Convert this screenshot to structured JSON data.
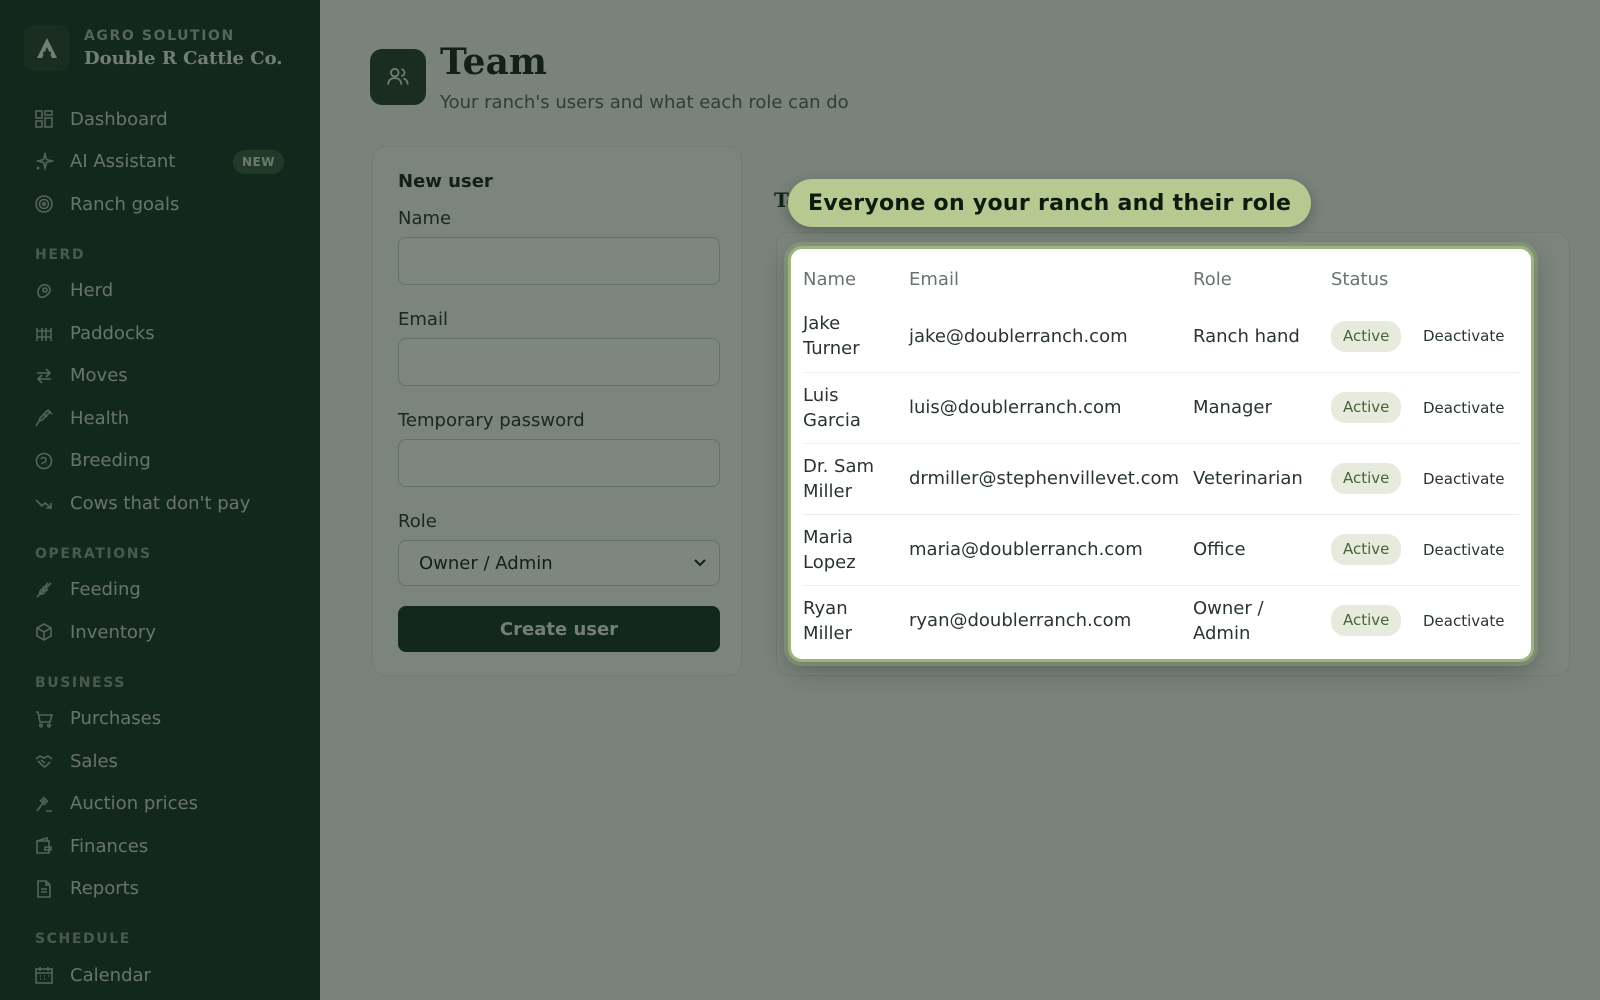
{
  "brand": {
    "kicker": "AGRO SOLUTION",
    "name": "Double R Cattle Co."
  },
  "sidebar": {
    "top": [
      {
        "label": "Dashboard",
        "icon": "dashboard-icon"
      },
      {
        "label": "AI Assistant",
        "icon": "sparkle-icon",
        "badge": "NEW"
      },
      {
        "label": "Ranch goals",
        "icon": "target-icon"
      }
    ],
    "herd_section": "HERD",
    "herd": [
      {
        "label": "Herd",
        "icon": "cow-icon"
      },
      {
        "label": "Paddocks",
        "icon": "fence-icon"
      },
      {
        "label": "Moves",
        "icon": "arrows-icon"
      },
      {
        "label": "Health",
        "icon": "syringe-icon"
      },
      {
        "label": "Breeding",
        "icon": "breeding-icon"
      },
      {
        "label": "Cows that don't pay",
        "icon": "trend-down-icon"
      }
    ],
    "operations_section": "OPERATIONS",
    "operations": [
      {
        "label": "Feeding",
        "icon": "wheat-icon"
      },
      {
        "label": "Inventory",
        "icon": "box-icon"
      }
    ],
    "business_section": "BUSINESS",
    "business": [
      {
        "label": "Purchases",
        "icon": "cart-icon"
      },
      {
        "label": "Sales",
        "icon": "handshake-icon"
      },
      {
        "label": "Auction prices",
        "icon": "gavel-icon"
      },
      {
        "label": "Finances",
        "icon": "wallet-icon"
      },
      {
        "label": "Reports",
        "icon": "document-icon"
      }
    ],
    "schedule_section": "SCHEDULE",
    "schedule": [
      {
        "label": "Calendar",
        "icon": "calendar-icon"
      }
    ]
  },
  "header": {
    "title": "Team",
    "subtitle": "Your ranch's users and what each role can do"
  },
  "new_user": {
    "title": "New user",
    "name_label": "Name",
    "email_label": "Email",
    "password_label": "Temporary password",
    "role_label": "Role",
    "role_value": "Owner / Admin",
    "create_label": "Create user"
  },
  "team": {
    "title_peek": "Te"
  },
  "tour": {
    "text": "Everyone on your ranch and their role"
  },
  "table": {
    "headers": [
      "Name",
      "Email",
      "Role",
      "Status"
    ],
    "rows": [
      {
        "name": "Jake Turner",
        "email": "jake@doublerranch.com",
        "role": "Ranch hand",
        "status": "Active",
        "action": "Deactivate"
      },
      {
        "name": "Luis Garcia",
        "email": "luis@doublerranch.com",
        "role": "Manager",
        "status": "Active",
        "action": "Deactivate"
      },
      {
        "name": "Dr. Sam Miller",
        "email": "drmiller@stephenvillevet.com",
        "role": "Veterinarian",
        "status": "Active",
        "action": "Deactivate"
      },
      {
        "name": "Maria Lopez",
        "email": "maria@doublerranch.com",
        "role": "Office",
        "status": "Active",
        "action": "Deactivate"
      },
      {
        "name": "Ryan Miller",
        "email": "ryan@doublerranch.com",
        "role": "Owner / Admin",
        "status": "Active",
        "action": "Deactivate"
      }
    ]
  }
}
